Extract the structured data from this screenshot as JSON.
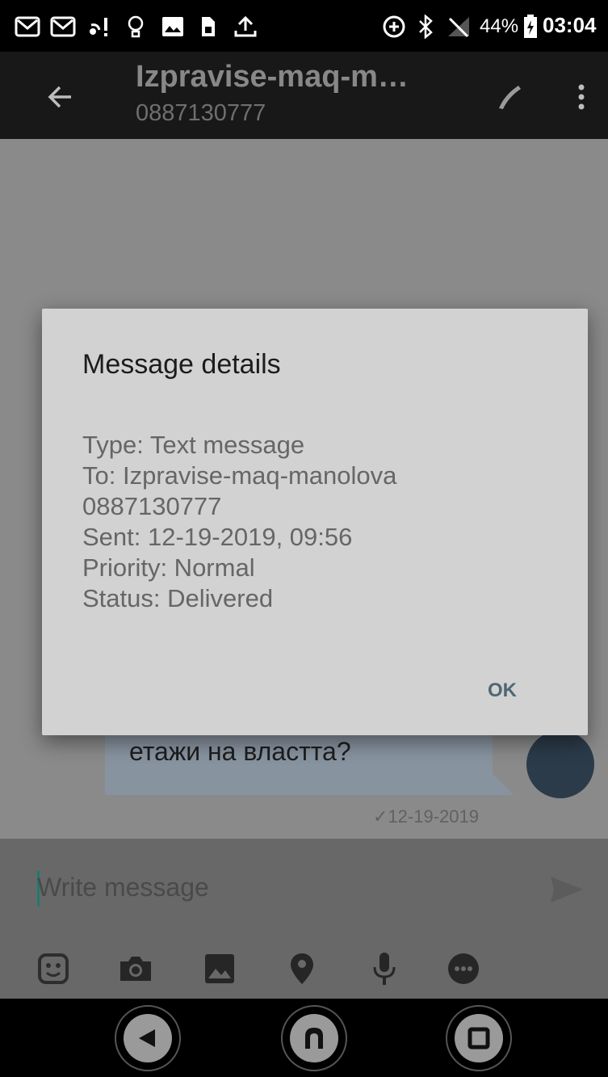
{
  "status_bar": {
    "battery_percent": "44%",
    "time": "03:04",
    "icons": [
      "gmail-icon",
      "gmail-icon",
      "wifi-alert-icon",
      "lightbulb-icon",
      "image-icon",
      "sim-icon",
      "upload-icon",
      "data-saver-icon",
      "bluetooth-icon",
      "no-signal-icon",
      "battery-charging-icon"
    ]
  },
  "app_bar": {
    "title": "Izpravise-maq-m…",
    "subtitle": "0887130777",
    "actions": [
      "back-arrow-icon",
      "phone-icon",
      "more-vertical-icon"
    ]
  },
  "conversation": {
    "message_text": "етажи на властта?",
    "message_time": "✓12-19-2019"
  },
  "dialog": {
    "title": "Message details",
    "lines": [
      "Type: Text message",
      "To: Izpravise-maq-manolova",
      "0887130777",
      "Sent: 12-19-2019, 09:56",
      "Priority: Normal",
      "Status: Delivered"
    ],
    "ok_label": "OK"
  },
  "composer": {
    "placeholder": "Write message",
    "attachment_icons": [
      "sticker-icon",
      "camera-icon",
      "gallery-icon",
      "location-icon",
      "microphone-icon",
      "more-options-icon"
    ]
  },
  "nav_bar": {
    "buttons": [
      "nav-back-button",
      "nav-home-button",
      "nav-recents-button"
    ]
  },
  "colors": {
    "dialog_bg": "#d2d2d2",
    "ok_text": "#4d6775",
    "overlay_chat_bg": "#8a8a8a",
    "status_bar_bg": "#000000",
    "app_bar_bg": "#181818"
  }
}
